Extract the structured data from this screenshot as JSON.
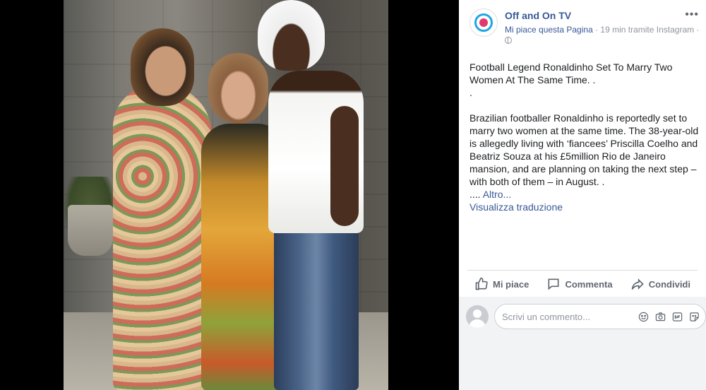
{
  "post": {
    "page_name": "Off and On TV",
    "like_page": "Mi piace questa Pagina",
    "meta_rest": " · 19 min tramite Instagram · ",
    "text_line1": "Football Legend Ronaldinho Set To Marry Two Women At The Same Time. .",
    "text_line2": ".",
    "text_body": "Brazilian footballer Ronaldinho is reportedly set to marry two women at the same time. The 38-year-old is allegedly living with ‘fiancees’ Priscilla Coelho and Beatriz Souza at his £5million Rio de Janeiro mansion, and are planning on taking the next step – with both of them – in August. .",
    "ellipsis": ".... ",
    "more_link": "Altro...",
    "translate": "Visualizza traduzione"
  },
  "actions": {
    "like": "Mi piace",
    "comment": "Commenta",
    "share": "Condividi"
  },
  "comment": {
    "placeholder": "Scrivi un commento..."
  },
  "icons": {
    "more": "more-horizontal-icon",
    "globe": "globe-icon",
    "like": "thumbs-up-icon",
    "comment": "speech-bubble-icon",
    "share": "share-arrow-icon",
    "emoji": "emoji-icon",
    "camera": "camera-icon",
    "gif": "gif-icon",
    "sticker": "sticker-icon"
  },
  "colors": {
    "link": "#385898",
    "muted": "#90949c",
    "text": "#1c1e21"
  }
}
